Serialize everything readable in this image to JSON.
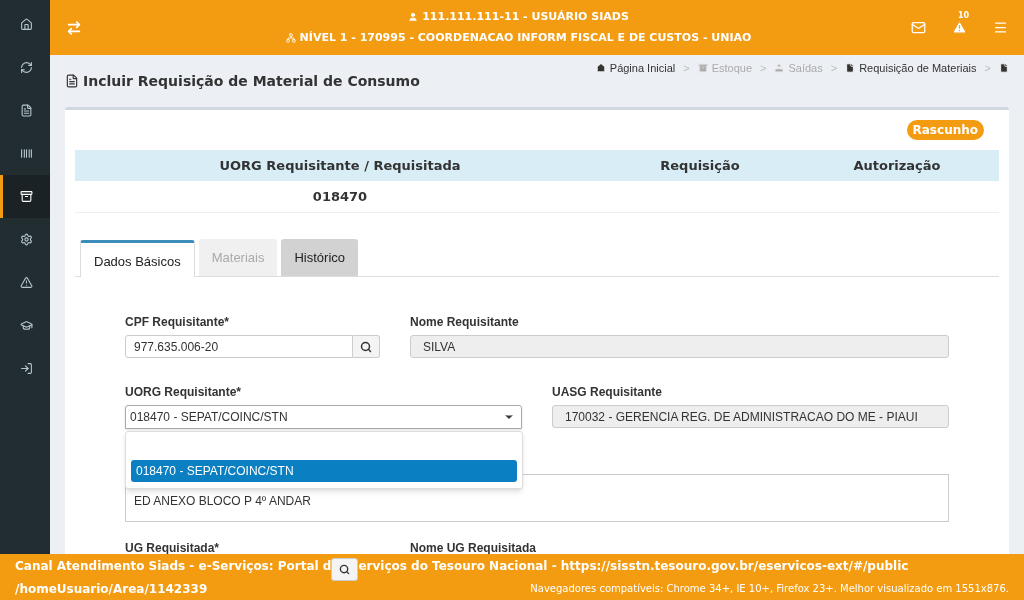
{
  "sidebar": {
    "items": [
      {
        "kind": "home",
        "selected": false
      },
      {
        "kind": "refresh",
        "selected": false
      },
      {
        "kind": "file",
        "selected": false
      },
      {
        "kind": "barcode",
        "selected": false
      },
      {
        "kind": "archive",
        "selected": true
      },
      {
        "kind": "cogs",
        "selected": false
      },
      {
        "kind": "warning",
        "selected": false
      },
      {
        "kind": "graduation",
        "selected": false
      },
      {
        "kind": "signin",
        "selected": false
      }
    ]
  },
  "header": {
    "user": "111.111.111-11 - USUÁRIO SIADS",
    "level": "NÍVEL 1 - 170995 - COORDENACAO INFORM FISCAL E DE CUSTOS - UNIAO",
    "alerts_badge": "10"
  },
  "page_title": "Incluir Requisição de Material de Consumo",
  "breadcrumb": {
    "separator": ">",
    "items": [
      {
        "label": "Página Inicial",
        "kind": "home",
        "disabled": false
      },
      {
        "label": "Estoque",
        "kind": "archive",
        "disabled": true
      },
      {
        "label": "Saídas",
        "kind": "upload",
        "disabled": true
      },
      {
        "label": "Requisição de Materiais",
        "kind": "file",
        "disabled": false
      },
      {
        "kind": "file",
        "disabled": false
      }
    ]
  },
  "status_badge": "Rascunho",
  "summary_table": {
    "columns": [
      "UORG Requisitante / Requisitada",
      "Requisição",
      "Autorização"
    ],
    "rows": [
      {
        "cells": [
          "018470"
        ]
      }
    ]
  },
  "tabs": [
    {
      "label": "Dados Básicos",
      "selected": true,
      "disabled": false
    },
    {
      "label": "Materiais",
      "selected": false,
      "disabled": true
    },
    {
      "label": "Histórico",
      "selected": false,
      "disabled": false
    }
  ],
  "form": {
    "cpf": {
      "label": "CPF Requisitante*",
      "value": "977.635.006-20"
    },
    "nome": {
      "label": "Nome Requisitante",
      "value": "SILVA"
    },
    "uorg": {
      "label": "UORG Requisitante*",
      "value": "018470 - SEPAT/COINC/STN",
      "expanded": true,
      "options": [
        {
          "label": "018470 - SEPAT/COINC/STN",
          "selected": true
        }
      ]
    },
    "uasg": {
      "label": "UASG Requisitante",
      "value": "170032 - GERENCIA REG. DE ADMINISTRACAO DO ME - PIAUI"
    },
    "address": {
      "value": "ED ANEXO BLOCO P 4º ANDAR"
    },
    "ug_label": "UG Requisitada*",
    "nome_ug_label": "Nome UG Requisitada"
  },
  "footer": {
    "line1_start": "Canal Atendimento Siads - e-Serviços: Portal d",
    "line1_end": "erviços do Tesouro Nacional - https://sisstn.tesouro.gov.br/eservicos-ext/#/public",
    "line2": "/homeUsuario/Area/1142339",
    "browsers": "Navegadores compatíveis: Chrome 34+, IE 10+, Firefox 23+. Melhor visualizado em 1551x876."
  }
}
